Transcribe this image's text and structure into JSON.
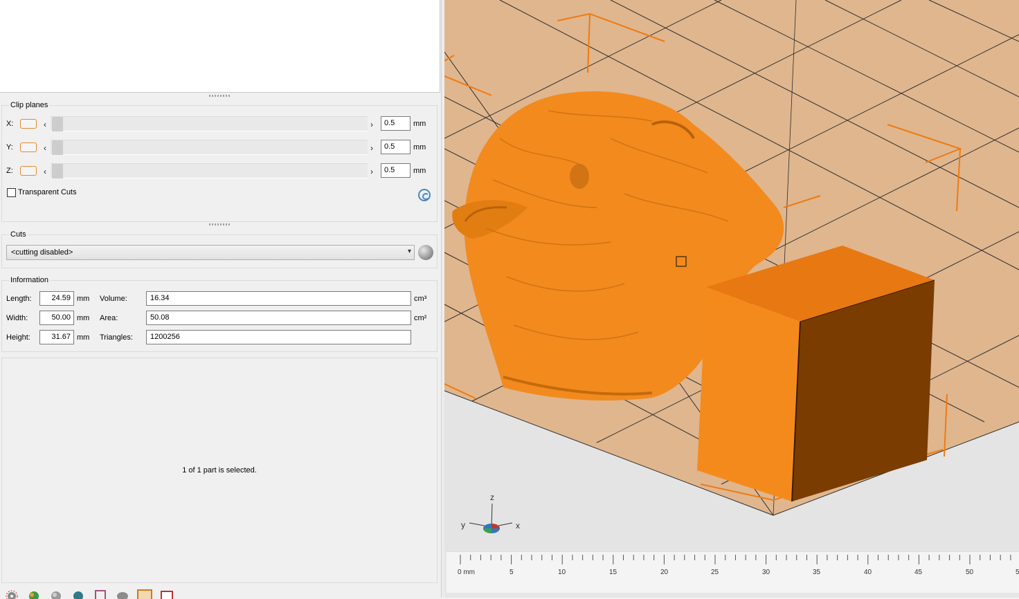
{
  "clip_planes": {
    "title": "Clip planes",
    "rows": [
      {
        "axis": "X:",
        "value": "0.5",
        "unit": "mm"
      },
      {
        "axis": "Y:",
        "value": "0.5",
        "unit": "mm"
      },
      {
        "axis": "Z:",
        "value": "0.5",
        "unit": "mm"
      }
    ],
    "transparent_cuts_label": "Transparent Cuts",
    "transparent_cuts_checked": false
  },
  "cuts": {
    "title": "Cuts",
    "selected": "<cutting disabled>"
  },
  "information": {
    "title": "Information",
    "length": {
      "label": "Length:",
      "value": "24.59",
      "unit": "mm"
    },
    "width": {
      "label": "Width:",
      "value": "50.00",
      "unit": "mm"
    },
    "height": {
      "label": "Height:",
      "value": "31.67",
      "unit": "mm"
    },
    "volume": {
      "label": "Volume:",
      "value": "16.34",
      "unit": "cm³"
    },
    "area": {
      "label": "Area:",
      "value": "50.08",
      "unit": "cm²"
    },
    "triangles": {
      "label": "Triangles:",
      "value": "1200256"
    }
  },
  "status": "1 of 1 part is selected.",
  "ruler": {
    "labels": [
      "0 mm",
      "5",
      "10",
      "15",
      "20",
      "25",
      "30",
      "35",
      "40",
      "45",
      "50",
      "5"
    ]
  },
  "axes": {
    "x": "x",
    "y": "y",
    "z": "z"
  },
  "colors": {
    "model": "#f28a1e",
    "bed": "#dfb68e",
    "cube_dark": "#7a3c00",
    "grid_line": "#222222",
    "bounding_box": "#f07a10"
  },
  "toolbar_icons": [
    "gear-icon",
    "leaf-icon",
    "sphere-icon",
    "half-sphere-icon",
    "frame-icon",
    "dome-icon",
    "select-icon",
    "calendar-icon"
  ]
}
